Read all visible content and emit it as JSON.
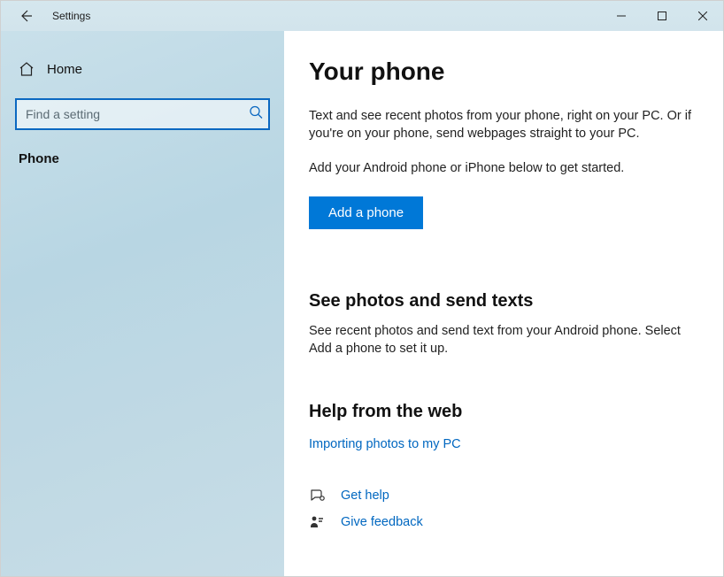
{
  "titlebar": {
    "title": "Settings"
  },
  "sidebar": {
    "home_label": "Home",
    "search_placeholder": "Find a setting",
    "nav": {
      "phone": "Phone"
    }
  },
  "main": {
    "heading": "Your phone",
    "intro1": "Text and see recent photos from your phone, right on your PC. Or if you're on your phone, send webpages straight to your PC.",
    "intro2": "Add your Android phone or iPhone below to get started.",
    "add_button": "Add a phone",
    "section_photos_heading": "See photos and send texts",
    "section_photos_body": "See recent photos and send text from your Android phone. Select Add a phone to set it up.",
    "section_help_heading": "Help from the web",
    "help_link_importing": "Importing photos to my PC",
    "get_help": "Get help",
    "give_feedback": "Give feedback"
  }
}
